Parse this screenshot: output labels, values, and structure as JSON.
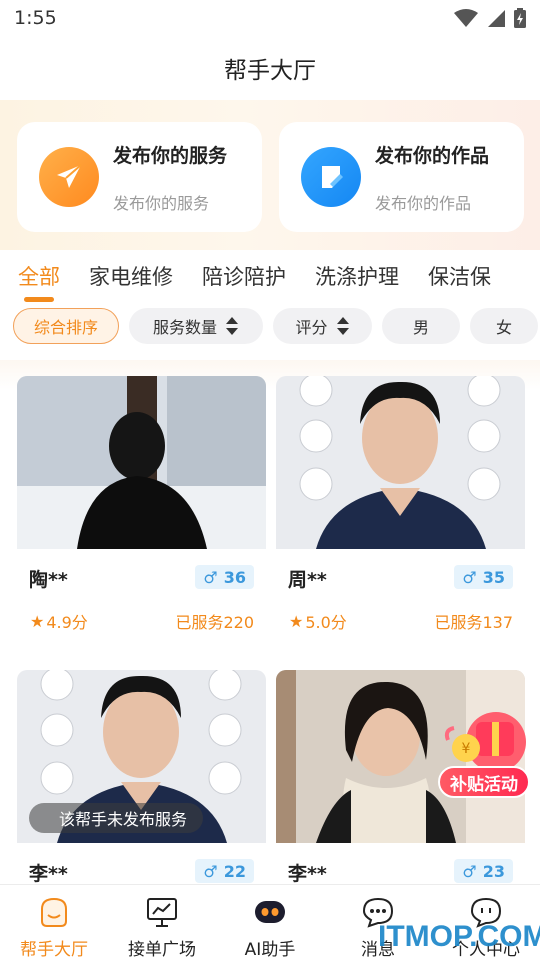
{
  "status_bar": {
    "time": "1:55"
  },
  "header": {
    "title": "帮手大厅"
  },
  "publish": {
    "service": {
      "title": "发布你的服务",
      "subtitle": "发布你的服务",
      "icon": "paper-plane-icon"
    },
    "works": {
      "title": "发布你的作品",
      "subtitle": "发布你的作品",
      "icon": "edit-document-icon"
    }
  },
  "categories": {
    "active_index": 0,
    "items": [
      "全部",
      "家电维修",
      "陪诊陪护",
      "洗涤护理",
      "保洁保"
    ]
  },
  "filters": {
    "sort_label": "综合排序",
    "service_count_label": "服务数量",
    "rating_label": "评分",
    "male_label": "男",
    "female_label": "女"
  },
  "helpers": [
    {
      "name": "陶**",
      "gender_symbol": "♂",
      "count": "36",
      "rating": "4.9分",
      "served": "已服务220"
    },
    {
      "name": "周**",
      "gender_symbol": "♂",
      "count": "35",
      "rating": "5.0分",
      "served": "已服务137"
    },
    {
      "name": "李**",
      "gender_symbol": "♂",
      "count": "22",
      "overlay": "该帮手未发布服务"
    },
    {
      "name": "李**",
      "gender_symbol": "♂",
      "count": "23"
    }
  ],
  "promo": {
    "label": "补贴活动"
  },
  "bottom_nav": [
    {
      "label": "帮手大厅",
      "icon": "helper-hall-icon",
      "active": true
    },
    {
      "label": "接单广场",
      "icon": "order-plaza-icon",
      "active": false
    },
    {
      "label": "AI助手",
      "icon": "ai-assistant-icon",
      "active": false
    },
    {
      "label": "消息",
      "icon": "message-icon",
      "active": false
    },
    {
      "label": "个人中心",
      "icon": "profile-icon",
      "active": false
    }
  ],
  "watermark": {
    "text": "ITMOP.COM"
  },
  "colors": {
    "accent": "#f28a1c",
    "male_badge": "#3b98dc",
    "promo_red": "#ff2a51"
  }
}
